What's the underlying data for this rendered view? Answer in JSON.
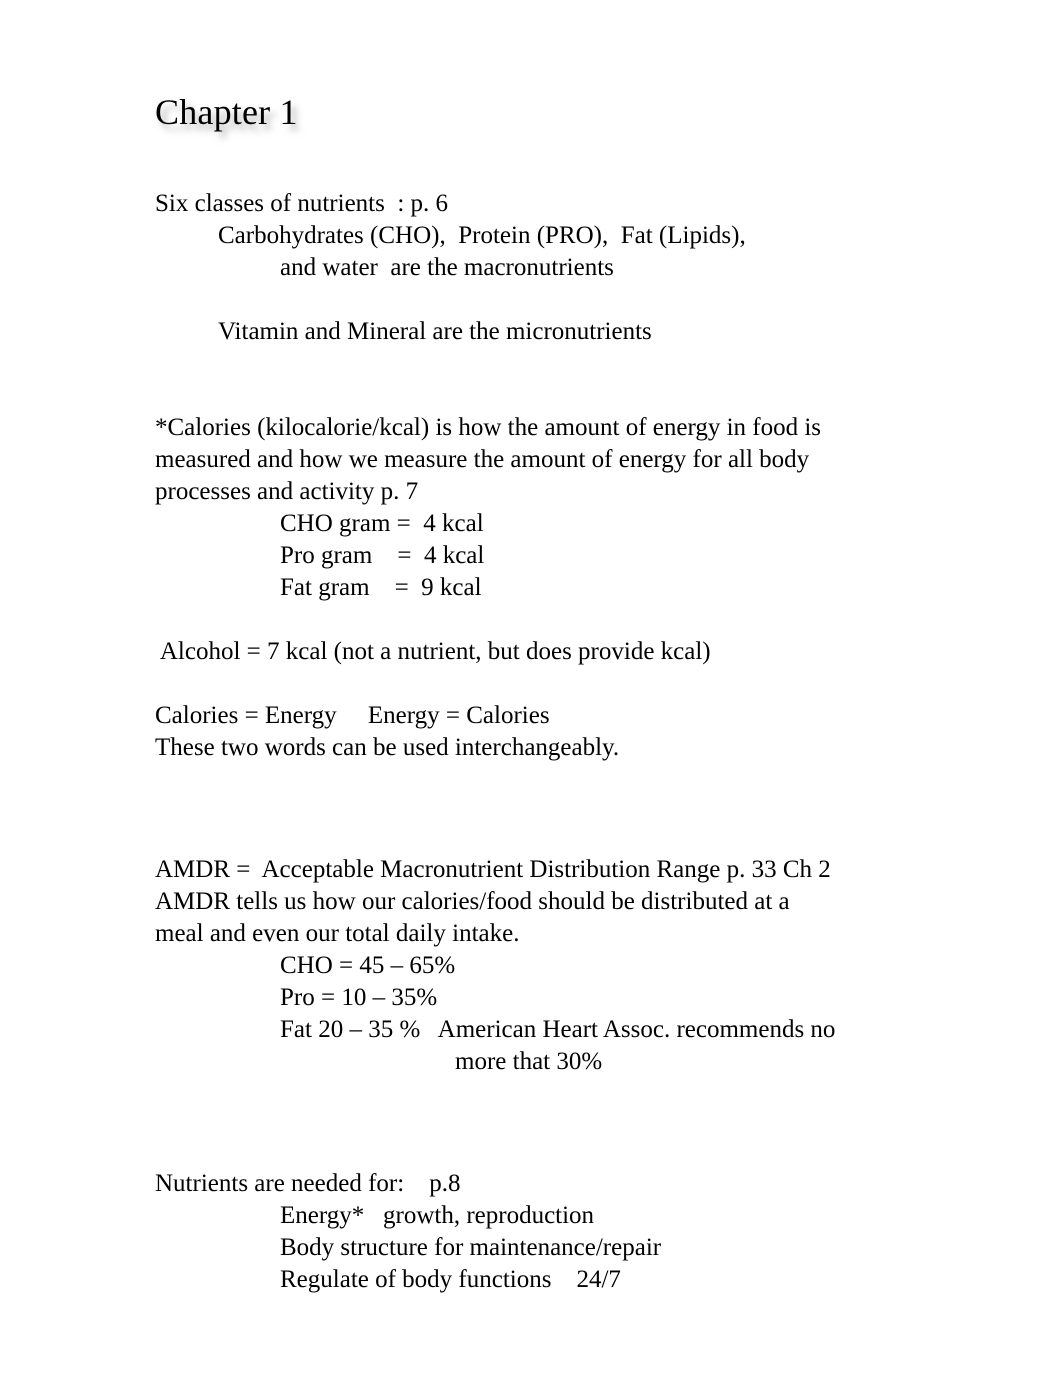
{
  "document": {
    "title": "Chapter 1",
    "background_color": "#ffffff",
    "text_color": "#000000",
    "title_shadow_color": "#787878"
  },
  "sections": {
    "nutrient_classes": {
      "heading": "Six classes of nutrients  : p. 6",
      "line_macros": "Carbohydrates (CHO),  Protein (PRO),  Fat (Lipids),",
      "line_macros_cont": "and water  are the macronutrients",
      "line_micros": "Vitamin and Mineral are the micronutrients"
    },
    "calories": {
      "paragraph": "*Calories (kilocalorie/kcal) is how the amount of energy in food is measured and how we measure the amount of energy for all body processes and activity p. 7",
      "para_line_1": "*Calories (kilocalorie/kcal) is how the amount of energy in food is",
      "para_line_2": "measured and how we measure the amount of energy for all body",
      "para_line_3": "processes and activity p. 7",
      "values": [
        "CHO gram =  4 kcal",
        "Pro gram    =  4 kcal",
        "Fat gram    =  9 kcal"
      ],
      "alcohol": " Alcohol = 7 kcal (not a nutrient, but does provide kcal)",
      "equivalence_line": "Calories = Energy     Energy = Calories",
      "equivalence_note": "These two words can be used interchangeably."
    },
    "amdr": {
      "definition_line_1": "AMDR =  Acceptable Macronutrient Distribution Range p. 33 Ch 2",
      "definition_line_2": "AMDR tells us how our calories/food should be distributed at a",
      "definition_line_3": "meal and even our total daily intake.",
      "ranges": [
        "CHO = 45 – 65%",
        "Pro = 10 – 35%",
        "Fat 20 – 35 %   American Heart Assoc. recommends no"
      ],
      "ranges_continuation": "more that 30%"
    },
    "nutrient_functions": {
      "heading": "Nutrients are needed for:    p.8",
      "items": [
        "Energy*   growth, reproduction",
        "Body structure for maintenance/repair",
        "Regulate of body functions    24/7"
      ]
    }
  }
}
